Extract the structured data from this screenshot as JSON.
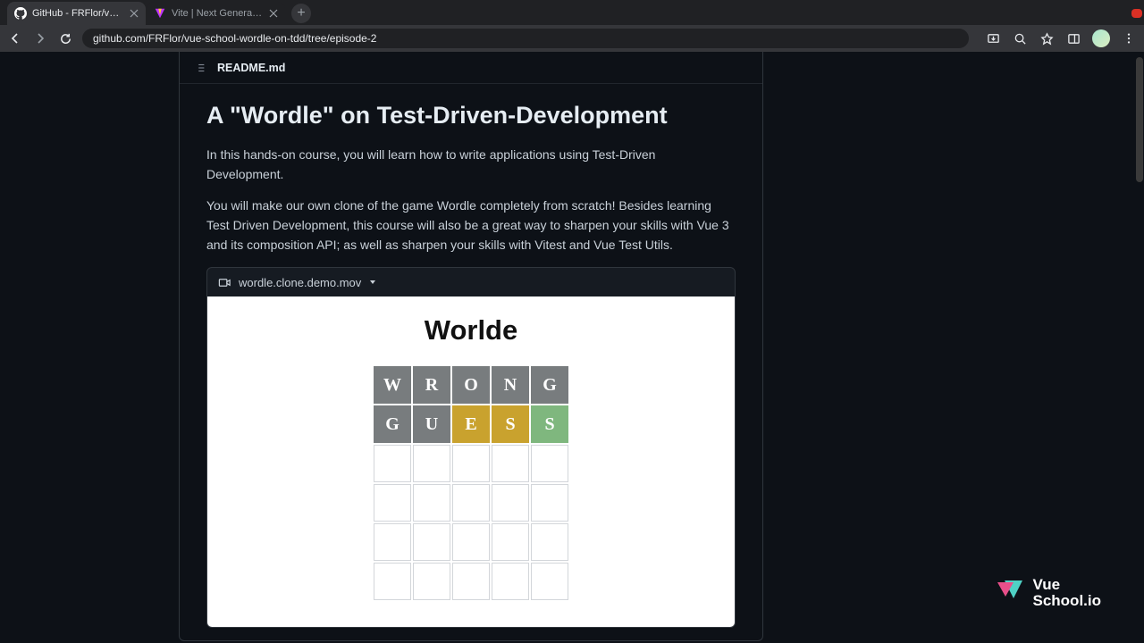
{
  "browser": {
    "tabs": [
      {
        "title": "GitHub - FRFlor/vue-school-...",
        "active": true
      },
      {
        "title": "Vite | Next Generation Fronte",
        "active": false
      }
    ],
    "url": "github.com/FRFlor/vue-school-wordle-on-tdd/tree/episode-2"
  },
  "readme": {
    "filename": "README.md",
    "heading": "A \"Wordle\" on Test-Driven-Development",
    "para1": "In this hands-on course, you will learn how to write applications using Test-Driven Development.",
    "para2": "You will make our own clone of the game Wordle completely from scratch! Besides learning Test Driven Development, this course will also be a great way to sharpen your skills with Vue 3 and its composition API; as well as sharpen your skills with Vitest and Vue Test Utils.",
    "video_filename": "wordle.clone.demo.mov"
  },
  "game": {
    "title": "Worlde",
    "rows": [
      [
        {
          "letter": "W",
          "state": "absent"
        },
        {
          "letter": "R",
          "state": "absent"
        },
        {
          "letter": "O",
          "state": "absent"
        },
        {
          "letter": "N",
          "state": "absent"
        },
        {
          "letter": "G",
          "state": "absent"
        }
      ],
      [
        {
          "letter": "G",
          "state": "absent"
        },
        {
          "letter": "U",
          "state": "absent"
        },
        {
          "letter": "E",
          "state": "present"
        },
        {
          "letter": "S",
          "state": "present"
        },
        {
          "letter": "S",
          "state": "correct"
        }
      ],
      [
        {
          "letter": "",
          "state": "empty"
        },
        {
          "letter": "",
          "state": "empty"
        },
        {
          "letter": "",
          "state": "empty"
        },
        {
          "letter": "",
          "state": "empty"
        },
        {
          "letter": "",
          "state": "empty"
        }
      ],
      [
        {
          "letter": "",
          "state": "empty"
        },
        {
          "letter": "",
          "state": "empty"
        },
        {
          "letter": "",
          "state": "empty"
        },
        {
          "letter": "",
          "state": "empty"
        },
        {
          "letter": "",
          "state": "empty"
        }
      ],
      [
        {
          "letter": "",
          "state": "empty"
        },
        {
          "letter": "",
          "state": "empty"
        },
        {
          "letter": "",
          "state": "empty"
        },
        {
          "letter": "",
          "state": "empty"
        },
        {
          "letter": "",
          "state": "empty"
        }
      ],
      [
        {
          "letter": "",
          "state": "empty"
        },
        {
          "letter": "",
          "state": "empty"
        },
        {
          "letter": "",
          "state": "empty"
        },
        {
          "letter": "",
          "state": "empty"
        },
        {
          "letter": "",
          "state": "empty"
        }
      ]
    ]
  },
  "watermark": {
    "line1": "Vue",
    "line2": "School.io"
  }
}
